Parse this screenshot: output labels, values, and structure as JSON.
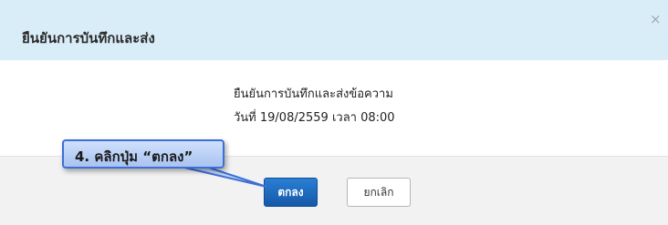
{
  "dialog": {
    "title": "ยืนยันการบันทึกและส่ง",
    "close_icon": "×",
    "message_line1": "ยืนยันการบันทึกและส่งข้อความ",
    "message_line2": "วันที่ 19/08/2559 เวลา 08:00"
  },
  "footer": {
    "ok_label": "ตกลง",
    "cancel_label": "ยกเลิก"
  },
  "annotation": {
    "text": "4. คลิกปุ่ม “ตกลง”"
  },
  "colors": {
    "header_bg": "#d9edf8",
    "footer_bg": "#f2f2f2",
    "primary_button": "#1a64b8",
    "callout_fill": "#bcd2f7",
    "callout_border": "#3d6fd6"
  }
}
